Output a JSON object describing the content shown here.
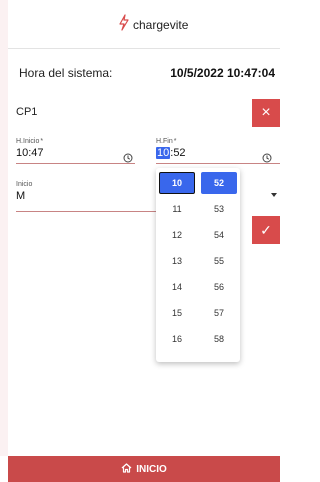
{
  "brand": {
    "name": "chargevite"
  },
  "system": {
    "label": "Hora del sistema:",
    "value": "10/5/2022 10:47:04"
  },
  "section": {
    "title": "CP1"
  },
  "start_field": {
    "label": "H.Inicio",
    "required_mark": "*",
    "value": "10:47"
  },
  "end_field": {
    "label": "H.Fin",
    "required_mark": "*",
    "hour": "10",
    "separator": ":",
    "minute": "52"
  },
  "mode_field": {
    "label": "Inicio",
    "value": "M"
  },
  "time_picker": {
    "hours": [
      "10",
      "11",
      "12",
      "13",
      "14",
      "15",
      "16"
    ],
    "minutes": [
      "52",
      "53",
      "54",
      "55",
      "56",
      "57",
      "58"
    ],
    "selected_hour": "10",
    "selected_minute": "52"
  },
  "actions": {
    "delete_icon": "×",
    "confirm_icon": "✓"
  },
  "bottom_nav": {
    "label": "INICIO",
    "icon": "home-icon"
  },
  "colors": {
    "accent_red": "#d84b4b",
    "selection_blue": "#3967ec"
  }
}
